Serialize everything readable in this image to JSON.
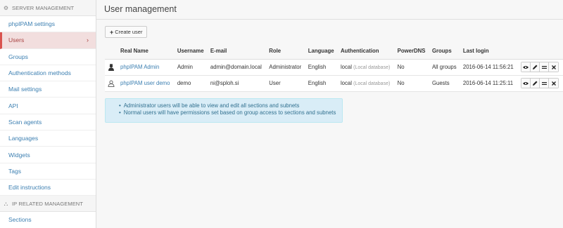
{
  "sidebar": {
    "server_header": "Server management",
    "items": [
      {
        "label": "phpIPAM settings"
      },
      {
        "label": "Users"
      },
      {
        "label": "Groups"
      },
      {
        "label": "Authentication methods"
      },
      {
        "label": "Mail settings"
      },
      {
        "label": "API"
      },
      {
        "label": "Scan agents"
      },
      {
        "label": "Languages"
      },
      {
        "label": "Widgets"
      },
      {
        "label": "Tags"
      },
      {
        "label": "Edit instructions"
      }
    ],
    "ip_header": "IP related management",
    "ip_items": [
      {
        "label": "Sections"
      }
    ],
    "active_item": "Users",
    "chevron": "›"
  },
  "main": {
    "title": "User management",
    "create_button": "Create user",
    "create_icon": "+"
  },
  "table": {
    "headers": [
      "",
      "Real Name",
      "Username",
      "E-mail",
      "Role",
      "Language",
      "Authentication",
      "PowerDNS",
      "Groups",
      "Last login",
      ""
    ],
    "rows": [
      {
        "avatar": "admin-avatar-icon",
        "real_name": "phpIPAM Admin",
        "username": "Admin",
        "email": "admin@domain.local",
        "role": "Administrator",
        "language": "English",
        "auth": "local",
        "auth_note": "(Local database)",
        "powerdns": "No",
        "groups": "All groups",
        "last_login": "2016-06-14 11:56:21"
      },
      {
        "avatar": "user-avatar-icon",
        "real_name": "phpIPAM user demo",
        "username": "demo",
        "email": "ni@sploh.si",
        "role": "User",
        "language": "English",
        "auth": "local",
        "auth_note": "(Local database)",
        "powerdns": "No",
        "groups": "Guests",
        "last_login": "2016-06-14 11:25:11"
      }
    ]
  },
  "info": {
    "lines": [
      "Administrator users will be able to view and edit all sections and subnets",
      "Normal users will have permissions set based on group access to sections and subnets"
    ]
  },
  "colors": {
    "link": "#3c7fb1",
    "active_bg": "#f2dede",
    "active_text": "#a94442",
    "info_bg": "#d9edf7",
    "info_text": "#31708f"
  }
}
